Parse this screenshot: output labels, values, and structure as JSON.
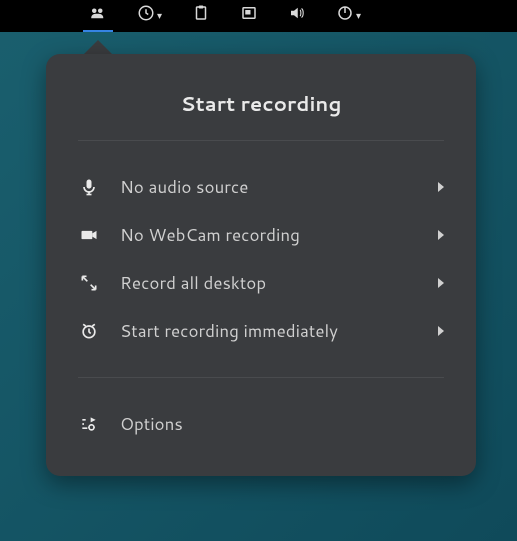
{
  "topbar": {
    "icons": [
      {
        "name": "easyscreencast-icon",
        "has_caret": false,
        "active": true
      },
      {
        "name": "clock-icon",
        "has_caret": true,
        "active": false
      },
      {
        "name": "clipboard-icon",
        "has_caret": false,
        "active": false
      },
      {
        "name": "workspace-icon",
        "has_caret": false,
        "active": false
      },
      {
        "name": "volume-icon",
        "has_caret": false,
        "active": false
      },
      {
        "name": "power-icon",
        "has_caret": true,
        "active": false
      }
    ]
  },
  "popover": {
    "title": "Start recording",
    "menu_items": [
      {
        "icon": "microphone-icon",
        "label": "No audio source",
        "has_submenu": true
      },
      {
        "icon": "webcam-icon",
        "label": "No WebCam recording",
        "has_submenu": true
      },
      {
        "icon": "fullscreen-icon",
        "label": "Record all desktop",
        "has_submenu": true
      },
      {
        "icon": "alarm-icon",
        "label": "Start recording immediately",
        "has_submenu": true
      }
    ],
    "options_item": {
      "icon": "settings-icon",
      "label": "Options",
      "has_submenu": false
    }
  }
}
